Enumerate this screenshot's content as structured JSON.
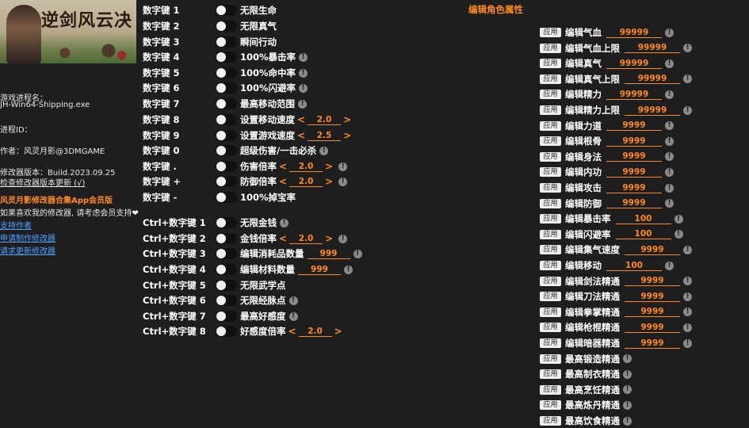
{
  "sidebar": {
    "banner_title": "逆剑风云决",
    "process_label": "游戏进程名：",
    "process_name": "JH-Win64-Shipping.exe",
    "pid_label": "进程ID：",
    "author": "作者：风灵月影@3DMGAME",
    "version": "修改器版本：Build.2023.09.25",
    "check_update": "检查修改器版本更新 (√)",
    "promo": "风灵月影修改器合集App会员版",
    "support_text": "如果喜欢我的修改器, 请考虑会员支持",
    "heart": "❤",
    "links": [
      "支持作者",
      "申请制作修改器",
      "请求更新修改器"
    ]
  },
  "left_rows": [
    {
      "key": "数字键 1",
      "label": "无限生命",
      "info": false
    },
    {
      "key": "数字键 2",
      "label": "无限真气",
      "info": false
    },
    {
      "key": "数字键 3",
      "label": "瞬间行动",
      "info": false
    },
    {
      "key": "数字键 4",
      "label": "100%暴击率",
      "info": true
    },
    {
      "key": "数字键 5",
      "label": "100%命中率",
      "info": true
    },
    {
      "key": "数字键 6",
      "label": "100%闪避率",
      "info": true
    },
    {
      "key": "数字键 7",
      "label": "最高移动范围",
      "info": true
    },
    {
      "key": "数字键 8",
      "label": "设置移动速度",
      "value": "2.0",
      "arrows": true,
      "info": false
    },
    {
      "key": "数字键 9",
      "label": "设置游戏速度",
      "value": "2.5",
      "arrows": true,
      "info": false
    },
    {
      "key": "数字键 0",
      "label": "超级伤害/一击必杀",
      "info": true
    },
    {
      "key": "数字键 .",
      "label": "伤害倍率",
      "value": "2.0",
      "arrows": true,
      "info": true
    },
    {
      "key": "数字键 +",
      "label": "防御倍率",
      "value": "2.0",
      "arrows": true,
      "info": true
    },
    {
      "key": "数字键 -",
      "label": "100%掉宝率",
      "info": false
    },
    {
      "key": "Ctrl+数字键 1",
      "label": "无限金钱",
      "info": true
    },
    {
      "key": "Ctrl+数字键 2",
      "label": "金钱倍率",
      "value": "2.0",
      "arrows": true,
      "info": true
    },
    {
      "key": "Ctrl+数字键 3",
      "label": "编辑消耗品数量",
      "value": "999",
      "arrows": false,
      "info": true
    },
    {
      "key": "Ctrl+数字键 4",
      "label": "编辑材料数量",
      "value": "999",
      "arrows": false,
      "info": true
    },
    {
      "key": "Ctrl+数字键 5",
      "label": "无限武学点",
      "info": false
    },
    {
      "key": "Ctrl+数字键 6",
      "label": "无限经脉点",
      "info": true
    },
    {
      "key": "Ctrl+数字键 7",
      "label": "最高好感度",
      "info": true
    },
    {
      "key": "Ctrl+数字键 8",
      "label": "好感度倍率",
      "value": "2.0",
      "arrows": true,
      "info": false
    }
  ],
  "right": {
    "title": "编辑角色属性",
    "apply_label": "应用",
    "info_symbol": "!",
    "arrow_left": "<",
    "arrow_right": ">",
    "rows": [
      {
        "label": "编辑气血",
        "value": "99999",
        "info": true
      },
      {
        "label": "编辑气血上限",
        "value": "99999",
        "info": true
      },
      {
        "label": "编辑真气",
        "value": "99999",
        "info": true
      },
      {
        "label": "编辑真气上限",
        "value": "99999",
        "info": true
      },
      {
        "label": "编辑精力",
        "value": "99999",
        "info": true
      },
      {
        "label": "编辑精力上限",
        "value": "99999",
        "info": true
      },
      {
        "label": "编辑力道",
        "value": "9999",
        "info": true
      },
      {
        "label": "编辑根骨",
        "value": "9999",
        "info": true
      },
      {
        "label": "编辑身法",
        "value": "9999",
        "info": true
      },
      {
        "label": "编辑内功",
        "value": "9999",
        "info": true
      },
      {
        "label": "编辑攻击",
        "value": "9999",
        "info": true
      },
      {
        "label": "编辑防御",
        "value": "9999",
        "info": true
      },
      {
        "label": "编辑暴击率",
        "value": "100",
        "info": true
      },
      {
        "label": "编辑闪避率",
        "value": "100",
        "info": true
      },
      {
        "label": "编辑集气速度",
        "value": "9999",
        "info": true
      },
      {
        "label": "编辑移动",
        "value": "100",
        "info": true
      },
      {
        "label": "编辑剑法精通",
        "value": "9999",
        "info": true
      },
      {
        "label": "编辑刀法精通",
        "value": "9999",
        "info": true
      },
      {
        "label": "编辑拳掌精通",
        "value": "9999",
        "info": true
      },
      {
        "label": "编辑枪棍精通",
        "value": "9999",
        "info": true
      },
      {
        "label": "编辑暗器精通",
        "value": "9999",
        "info": true
      },
      {
        "label": "最高锻造精通",
        "info": true
      },
      {
        "label": "最高制衣精通",
        "info": true
      },
      {
        "label": "最高烹饪精通",
        "info": true
      },
      {
        "label": "最高炼丹精通",
        "info": true
      },
      {
        "label": "最高饮食精通",
        "info": true
      }
    ]
  }
}
